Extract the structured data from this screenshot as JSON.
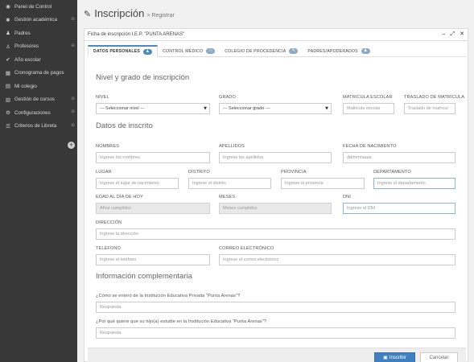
{
  "sidebar": {
    "items": [
      {
        "icon": "dashboard-icon",
        "glyph": "◉",
        "label": "Panel de Control",
        "expand": false
      },
      {
        "icon": "gear-icon",
        "glyph": "✱",
        "label": "Gestión académica",
        "expand": true
      },
      {
        "icon": "users-icon",
        "glyph": "♟",
        "label": "Padres",
        "expand": false
      },
      {
        "icon": "user-icon",
        "glyph": "♙",
        "label": "Profesores",
        "expand": true
      },
      {
        "icon": "check-icon",
        "glyph": "✔",
        "label": "Año escolar",
        "expand": false
      },
      {
        "icon": "calendar-icon",
        "glyph": "▦",
        "label": "Cronograma de pagos",
        "expand": false
      },
      {
        "icon": "building-icon",
        "glyph": "▤",
        "label": "Mi colegio",
        "expand": false
      },
      {
        "icon": "book-icon",
        "glyph": "▥",
        "label": "Gestión de cursos",
        "expand": true
      },
      {
        "icon": "cogs-icon",
        "glyph": "⚙",
        "label": "Configuraciones",
        "expand": true
      },
      {
        "icon": "list-icon",
        "glyph": "☰",
        "label": "Criterios de Libreta",
        "expand": true
      }
    ],
    "expand_glyph": "⊞",
    "toggle_glyph": "+"
  },
  "header": {
    "title": "Inscripción",
    "subtitle": "> Registrar"
  },
  "card": {
    "title": "Ficha de inscripción I.E.P. \"PUNTA ARENAS\"",
    "controls": [
      "‒",
      "⤢",
      "✕"
    ]
  },
  "tabs": [
    {
      "label": "DATOS PERSONALES",
      "badge": "♟",
      "active": true
    },
    {
      "label": "CONTROL MÉDICO",
      "badge": "▭",
      "active": false
    },
    {
      "label": "COLEGIO DE PROCEDENCIA",
      "badge": "✎",
      "active": false
    },
    {
      "label": "PADRES/APODERADOS",
      "badge": "♟",
      "active": false
    }
  ],
  "sections": {
    "nivel": "Nivel y grado de inscripción",
    "inscrito": "Datos de inscrito",
    "complementaria": "Información complementaria"
  },
  "form": {
    "nivel": {
      "label": "NIVEL",
      "value": "--- Seleccionar nivel ---"
    },
    "grado": {
      "label": "GRADO",
      "value": "--- Seleccionar grado ---"
    },
    "matricula": {
      "label": "MATRICULA ESCOLAR",
      "placeholder": "Matricula escolar"
    },
    "traslado": {
      "label": "TRASLADO DE MATRICULA",
      "placeholder": "Traslado de matricul"
    },
    "nombres": {
      "label": "NOMBRES",
      "placeholder": "Ingrese los nombres"
    },
    "apellidos": {
      "label": "APELLIDOS",
      "placeholder": "Ingrese los apellidos"
    },
    "nacimiento": {
      "label": "FECHA DE NACIMIENTO",
      "placeholder": "dd/mm/aaaa"
    },
    "lugar": {
      "label": "LUGAR",
      "placeholder": "Ingrese el lugar de nacimiento"
    },
    "distrito": {
      "label": "DISTRITO",
      "placeholder": "Ingrese el distrito"
    },
    "provincia": {
      "label": "PROVINCIA",
      "placeholder": "Ingrese la provincia"
    },
    "departamento": {
      "label": "DEPARTAMENTO",
      "placeholder": "Ingrese el departamento"
    },
    "edad": {
      "label": "EDAD AL DÍA DE HOY",
      "placeholder": "Años cumplidos"
    },
    "meses": {
      "label": "MESES",
      "placeholder": "Meses cumplidos"
    },
    "dni": {
      "label": "DNI",
      "placeholder": "Ingrese el DNI"
    },
    "direccion": {
      "label": "DIRECCIÓN",
      "placeholder": "Ingrese la dirección"
    },
    "telefono": {
      "label": "TELÉFONO",
      "placeholder": "Ingrese el teléfono"
    },
    "correo": {
      "label": "CORREO ELECTRÓNICO",
      "placeholder": "Ingrese el correo electrónico"
    },
    "pregunta1": {
      "label": "¿Cómo se enteró de la Institución Educativa Privada \"Punta Arenas\"?",
      "placeholder": "Respuesta"
    },
    "pregunta2": {
      "label": "¿Por qué quiere que su hijo(a) estudie en la Institución Educativa \"Punta Arenas\"?",
      "placeholder": "Respuesta"
    }
  },
  "buttons": {
    "submit": "Inscribir",
    "submit_icon": "▣",
    "cancel": "Cancelar"
  }
}
